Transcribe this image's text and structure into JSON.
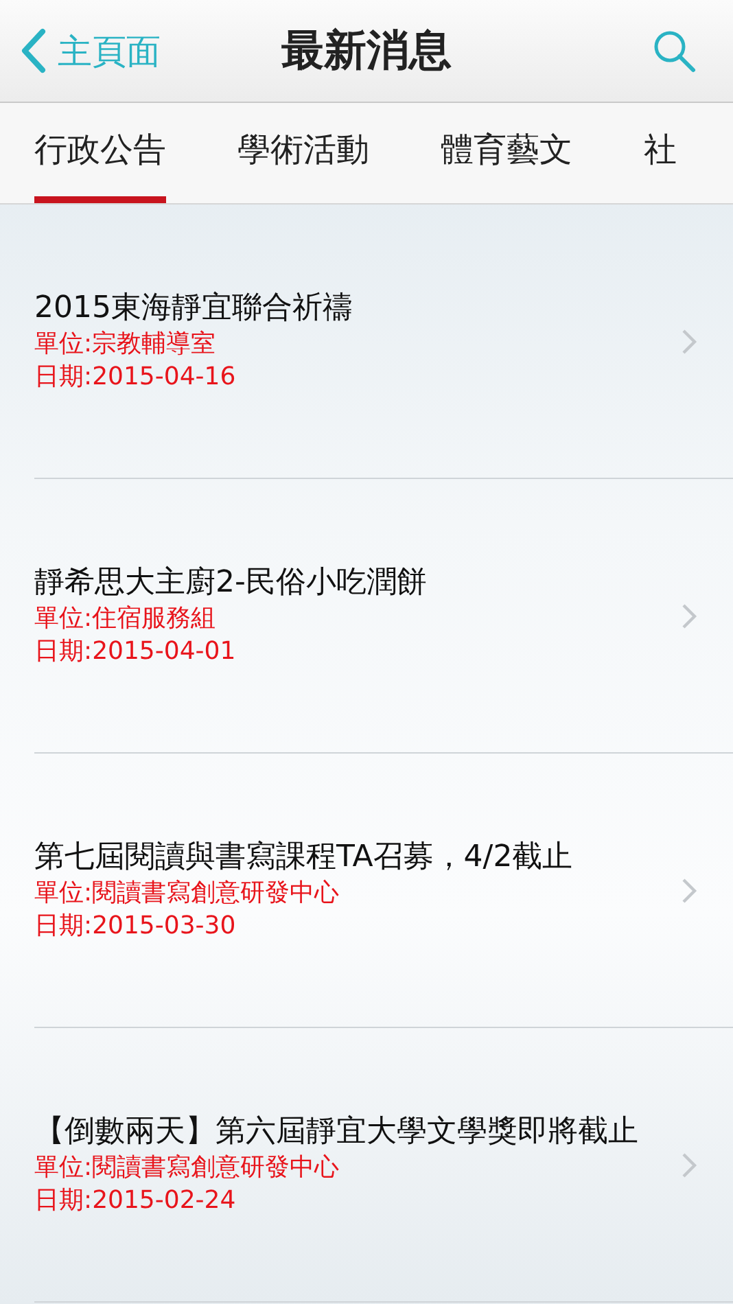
{
  "nav": {
    "back": "主頁面",
    "title": "最新消息"
  },
  "tabs": [
    {
      "label": "行政公告",
      "selected": true
    },
    {
      "label": "學術活動",
      "selected": false
    },
    {
      "label": "體育藝文",
      "selected": false
    },
    {
      "label": "社",
      "selected": false
    }
  ],
  "items": [
    {
      "title": "2015東海靜宜聯合祈禱",
      "unit": "單位:宗教輔導室",
      "date": "日期:2015-04-16"
    },
    {
      "title": "靜希思大主廚2-民俗小吃潤餅",
      "unit": "單位:住宿服務組",
      "date": "日期:2015-04-01"
    },
    {
      "title": "第七屆閱讀與書寫課程TA召募，4/2截止",
      "unit": "單位:閱讀書寫創意研發中心",
      "date": "日期:2015-03-30"
    },
    {
      "title": "【倒數兩天】第六屆靜宜大學文學獎即將截止",
      "unit": "單位:閱讀書寫創意研發中心",
      "date": "日期:2015-02-24"
    }
  ]
}
